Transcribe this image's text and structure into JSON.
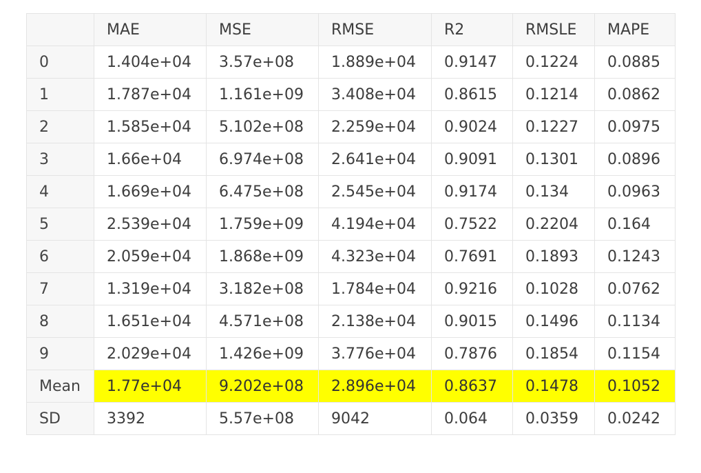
{
  "colors": {
    "header_bg": "#f7f7f7",
    "border": "#e4e4e4",
    "highlight": "#ffff00",
    "text": "#3d3d3d"
  },
  "table": {
    "columns": [
      "",
      "MAE",
      "MSE",
      "RMSE",
      "R2",
      "RMSLE",
      "MAPE"
    ],
    "rows": [
      [
        "0",
        "1.404e+04",
        "3.57e+08",
        "1.889e+04",
        "0.9147",
        "0.1224",
        "0.0885"
      ],
      [
        "1",
        "1.787e+04",
        "1.161e+09",
        "3.408e+04",
        "0.8615",
        "0.1214",
        "0.0862"
      ],
      [
        "2",
        "1.585e+04",
        "5.102e+08",
        "2.259e+04",
        "0.9024",
        "0.1227",
        "0.0975"
      ],
      [
        "3",
        "1.66e+04",
        "6.974e+08",
        "2.641e+04",
        "0.9091",
        "0.1301",
        "0.0896"
      ],
      [
        "4",
        "1.669e+04",
        "6.475e+08",
        "2.545e+04",
        "0.9174",
        "0.134",
        "0.0963"
      ],
      [
        "5",
        "2.539e+04",
        "1.759e+09",
        "4.194e+04",
        "0.7522",
        "0.2204",
        "0.164"
      ],
      [
        "6",
        "2.059e+04",
        "1.868e+09",
        "4.323e+04",
        "0.7691",
        "0.1893",
        "0.1243"
      ],
      [
        "7",
        "1.319e+04",
        "3.182e+08",
        "1.784e+04",
        "0.9216",
        "0.1028",
        "0.0762"
      ],
      [
        "8",
        "1.651e+04",
        "4.571e+08",
        "2.138e+04",
        "0.9015",
        "0.1496",
        "0.1134"
      ],
      [
        "9",
        "2.029e+04",
        "1.426e+09",
        "3.776e+04",
        "0.7876",
        "0.1854",
        "0.1154"
      ],
      [
        "Mean",
        "1.77e+04",
        "9.202e+08",
        "2.896e+04",
        "0.8637",
        "0.1478",
        "0.1052"
      ],
      [
        "SD",
        "3392",
        "5.57e+08",
        "9042",
        "0.064",
        "0.0359",
        "0.0242"
      ]
    ],
    "highlighted_row": "Mean"
  }
}
